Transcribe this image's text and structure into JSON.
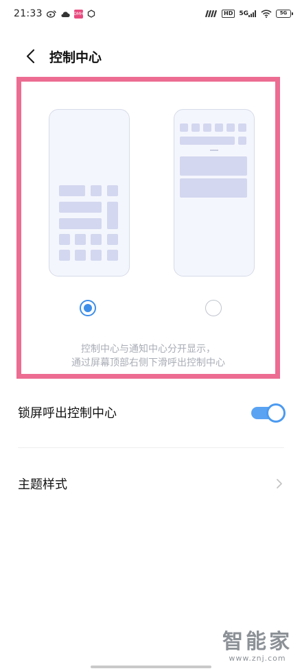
{
  "status_bar": {
    "time": "21:33",
    "left_icons": [
      "weibo-icon",
      "cloud-icon",
      "app-badge-icon",
      "circle-icon"
    ],
    "pink_badge_text": "DMH",
    "hd_label": "HD",
    "network_label": "5G",
    "battery_label": "5G"
  },
  "header": {
    "title": "控制中心",
    "back_icon": "chevron-left-icon"
  },
  "preview": {
    "highlight_color": "#ec6c92",
    "selected_option": 0,
    "description_line1": "控制中心与通知中心分开显示，",
    "description_line2": "通过屏幕顶部右侧下滑呼出控制中心"
  },
  "settings": {
    "lock_screen_label": "锁屏呼出控制中心",
    "lock_screen_enabled": true,
    "theme_label": "主题样式"
  },
  "watermark": {
    "big": "智能家",
    "small": "www.znj.com"
  },
  "colors": {
    "accent": "#3d8ee9",
    "highlight": "#ec6c92"
  }
}
